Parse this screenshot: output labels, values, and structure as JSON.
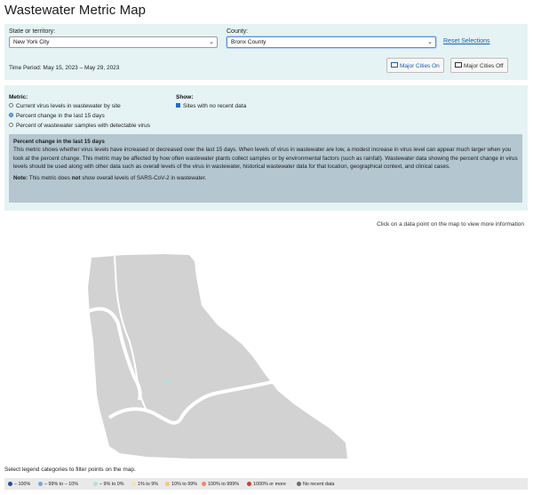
{
  "page": {
    "title": "Wastewater Metric Map"
  },
  "filters": {
    "state_label": "State or territory:",
    "state_value": "New York City",
    "county_label": "County:",
    "county_value": "Bronx County",
    "reset_label": "Reset Selections",
    "time_period": "Time Period: May 15, 2023 – May 29, 2023",
    "major_on_label": "Major Cities On",
    "major_off_label": "Major Cities Off"
  },
  "metric": {
    "heading": "Metric:",
    "options": [
      "Current virus levels in wastewater by site",
      "Percent change in the last 15 days",
      "Percent of wastewater samples with detectable virus"
    ],
    "selected_index": 1
  },
  "show": {
    "heading": "Show:",
    "checkbox_label": "Sites with no recent data",
    "checked": true
  },
  "description": {
    "title": "Percent change in the last 15 days",
    "body": "This metric shows whether virus levels have increased or decreased over the last 15 days. When levels of virus in wastewater are low, a modest increase in virus level can appear much larger when you look at the percent change. This metric may be affected by how often wastewater plants collect samples or by environmental factors (such as rainfall). Wastewater data showing the percent change in virus levels should be used along with other data such as overall levels of the virus in wastewater, historical wastewater data for that location, geographical context, and clinical cases.",
    "note_label": "Note:",
    "note_pre": "This metric does",
    "note_bold": "not",
    "note_post": "show overall levels of SARS-CoV-2 in wastewater."
  },
  "map": {
    "hint": "Click on a data point on the map to view more information",
    "land_color": "#d2d2d2",
    "point_color": "#a8e4e4"
  },
  "legend": {
    "hint": "Select legend categories to filter points on the map.",
    "items": [
      {
        "label": "– 100%",
        "color": "#1f4ea3"
      },
      {
        "label": "– 99% to – 10%",
        "color": "#6fa8dc"
      },
      {
        "label": "– 9% to 0%",
        "color": "#a8e4e4"
      },
      {
        "label": "1% to 9%",
        "color": "#f3e6a0"
      },
      {
        "label": "10% to 99%",
        "color": "#f7c873"
      },
      {
        "label": "100% to 999%",
        "color": "#ef8a5a"
      },
      {
        "label": "1000% or more",
        "color": "#d43a2a"
      },
      {
        "label": "No recent data",
        "color": "#6b6b6b"
      }
    ]
  }
}
